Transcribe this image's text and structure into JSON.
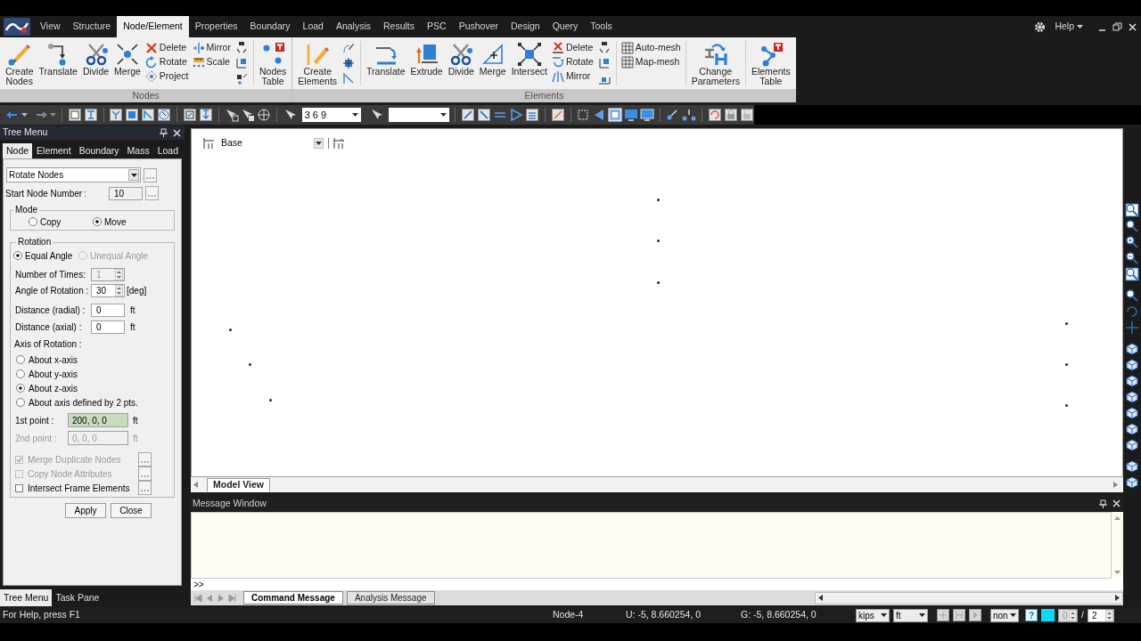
{
  "menu_bar": {
    "tabs": [
      {
        "label": "View",
        "selected": false
      },
      {
        "label": "Structure",
        "selected": false
      },
      {
        "label": "Node/Element",
        "selected": true
      },
      {
        "label": "Properties",
        "selected": false
      },
      {
        "label": "Boundary",
        "selected": false
      },
      {
        "label": "Load",
        "selected": false
      },
      {
        "label": "Analysis",
        "selected": false
      },
      {
        "label": "Results",
        "selected": false
      },
      {
        "label": "PSC",
        "selected": false
      },
      {
        "label": "Pushover",
        "selected": false
      },
      {
        "label": "Design",
        "selected": false
      },
      {
        "label": "Query",
        "selected": false
      },
      {
        "label": "Tools",
        "selected": false
      }
    ],
    "help": "Help"
  },
  "ribbon": {
    "groups": [
      {
        "title": "Nodes",
        "tools": [
          {
            "kind": "large",
            "label": "Create Nodes"
          },
          {
            "kind": "large",
            "label": "Translate"
          },
          {
            "kind": "large",
            "label": "Divide"
          },
          {
            "kind": "large",
            "label": "Merge"
          },
          {
            "kind": "stack",
            "items": [
              "Delete",
              "Rotate",
              "Project"
            ]
          },
          {
            "kind": "stack",
            "items": [
              "Mirror",
              "Scale"
            ]
          },
          {
            "kind": "icon_stack"
          },
          {
            "kind": "separator"
          },
          {
            "kind": "large",
            "label": "Nodes Table"
          }
        ]
      },
      {
        "title": "Elements",
        "tools": [
          {
            "kind": "large",
            "label": "Create Elements"
          },
          {
            "kind": "icon_stack"
          },
          {
            "kind": "separator"
          },
          {
            "kind": "large",
            "label": "Translate"
          },
          {
            "kind": "large",
            "label": "Extrude"
          },
          {
            "kind": "large",
            "label": "Divide"
          },
          {
            "kind": "large",
            "label": "Merge"
          },
          {
            "kind": "large",
            "label": "Intersect"
          },
          {
            "kind": "stack",
            "items": [
              "Delete",
              "Rotate",
              "Mirror"
            ]
          },
          {
            "kind": "icon_stack"
          },
          {
            "kind": "separator"
          },
          {
            "kind": "stack",
            "items": [
              "Auto-mesh",
              "Map-mesh"
            ]
          },
          {
            "kind": "separator"
          },
          {
            "kind": "large",
            "label": "Change Parameters"
          },
          {
            "kind": "separator"
          },
          {
            "kind": "large",
            "label": "Elements Table"
          }
        ]
      }
    ]
  },
  "toolbar": {
    "selection": "3 6 9"
  },
  "tree_menu": {
    "title": "Tree Menu",
    "tabs": [
      {
        "label": "Node",
        "selected": true
      },
      {
        "label": "Element",
        "selected": false
      },
      {
        "label": "Boundary",
        "selected": false
      },
      {
        "label": "Mass",
        "selected": false
      },
      {
        "label": "Load",
        "selected": false
      }
    ],
    "function": "Rotate Nodes",
    "start_node": {
      "label": "Start Node Number",
      "separator": ":",
      "value": "10"
    },
    "mode": {
      "title": "Mode",
      "options": [
        {
          "label": "Copy",
          "selected": false
        },
        {
          "label": "Move",
          "selected": true
        }
      ]
    },
    "rotation": {
      "title": "Rotation",
      "options": [
        {
          "label": "Equal Angle",
          "selected": true,
          "disabled": false
        },
        {
          "label": "Unequal Angle",
          "selected": false,
          "disabled": true
        }
      ],
      "fields": [
        {
          "kind": "spinner",
          "label": "Number of Times:",
          "value": "1",
          "disabled": true
        },
        {
          "kind": "spinner",
          "label": "Angle of Rotation :",
          "value": "30",
          "unit": "[deg]",
          "disabled": false
        },
        {
          "kind": "text",
          "label": "Distance (radial) :",
          "value": "0",
          "unit": "ft",
          "disabled": false
        },
        {
          "kind": "text",
          "label": "Distance (axial) :",
          "value": "0",
          "unit": "ft",
          "disabled": false
        }
      ],
      "axis_title": "Axis of Rotation :",
      "axis_options": [
        {
          "label": "About x-axis",
          "selected": false
        },
        {
          "label": "About y-axis",
          "selected": false
        },
        {
          "label": "About z-axis",
          "selected": true
        },
        {
          "label": "About axis defined by 2 pts.",
          "selected": false
        }
      ],
      "points": [
        {
          "label": "1st point :",
          "value": "200, 0, 0",
          "unit": "ft",
          "disabled": false,
          "highlighted": true
        },
        {
          "label": "2nd point :",
          "value": "0, 0, 0",
          "unit": "ft",
          "disabled": true,
          "highlighted": false
        }
      ],
      "checks": [
        {
          "label": "Merge Duplicate Nodes",
          "checked": true,
          "disabled": true
        },
        {
          "label": "Copy Node Attributes",
          "checked": false,
          "disabled": true
        },
        {
          "label": "Intersect Frame Elements",
          "checked": false,
          "disabled": false
        }
      ]
    },
    "buttons": [
      "Apply",
      "Close"
    ]
  },
  "model_view": {
    "level": "Base",
    "tab": "Model View"
  },
  "message_window": {
    "title": "Message Window",
    "prompt": ">>",
    "tabs": [
      {
        "label": "Command Message",
        "selected": true
      },
      {
        "label": "Analysis Message",
        "selected": false
      }
    ]
  },
  "bottom_tabs": [
    {
      "label": "Tree Menu",
      "selected": true
    },
    {
      "label": "Task Pane",
      "selected": false
    }
  ],
  "status_bar": {
    "help_text": "For Help, press F1",
    "node": "Node-4",
    "local_coords": "U: -5, 8.660254, 0",
    "global_coords": "G: -5, 8.660254, 0",
    "force_unit": "kips",
    "length_unit": "ft",
    "filter": "non",
    "help_button": "?",
    "page": "0",
    "page_separator": "/",
    "page_count": "2"
  }
}
